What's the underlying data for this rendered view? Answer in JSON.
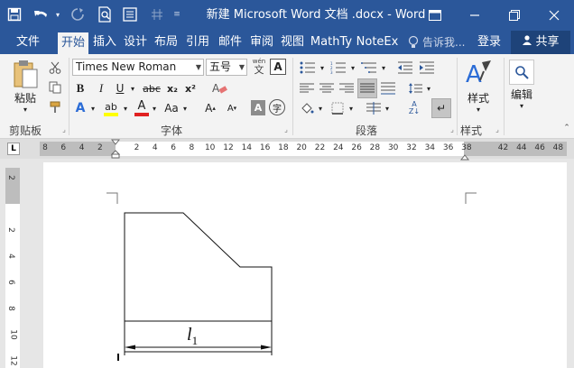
{
  "window": {
    "title": "新建 Microsoft Word 文档 .docx - Word"
  },
  "qat": {
    "save_icon": "save-icon",
    "undo_icon": "undo-icon",
    "redo_icon": "redo-icon",
    "print_preview_icon": "print-preview-icon",
    "touch_mode_icon": "touch-mode-icon"
  },
  "tabs": [
    {
      "label": "文件",
      "active": false
    },
    {
      "label": "开始",
      "active": true
    },
    {
      "label": "插入",
      "active": false
    },
    {
      "label": "设计",
      "active": false
    },
    {
      "label": "布局",
      "active": false
    },
    {
      "label": "引用",
      "active": false
    },
    {
      "label": "邮件",
      "active": false
    },
    {
      "label": "审阅",
      "active": false
    },
    {
      "label": "视图",
      "active": false
    },
    {
      "label": "MathTy",
      "active": false
    },
    {
      "label": "NoteEx",
      "active": false
    }
  ],
  "tell_me": "告诉我...",
  "login": "登录",
  "share": "共享",
  "ribbon": {
    "clipboard": {
      "paste_label": "粘贴",
      "group_label": "剪贴板"
    },
    "font": {
      "font_name": "Times New Roman",
      "font_size": "五号",
      "wen_label": "wén",
      "bold": "B",
      "italic": "I",
      "underline": "U",
      "strike": "abc",
      "subscript": "x₂",
      "superscript": "x²",
      "group_label": "字体"
    },
    "paragraph": {
      "group_label": "段落"
    },
    "styles": {
      "label": "样式",
      "group_label": "样式"
    },
    "editing": {
      "label": "编辑"
    }
  },
  "hruler": {
    "labels": [
      "8",
      "6",
      "4",
      "2",
      "",
      "2",
      "4",
      "6",
      "8",
      "10",
      "12",
      "14",
      "16",
      "18",
      "20",
      "22",
      "24",
      "26",
      "28",
      "30",
      "32",
      "34",
      "36",
      "38",
      "",
      "42",
      "44",
      "46",
      "48"
    ]
  },
  "vruler": {
    "labels": [
      "2",
      "",
      "2",
      "4",
      "6",
      "8",
      "10",
      "12"
    ]
  },
  "document": {
    "dimension_label": "l",
    "dimension_subscript": "1"
  }
}
